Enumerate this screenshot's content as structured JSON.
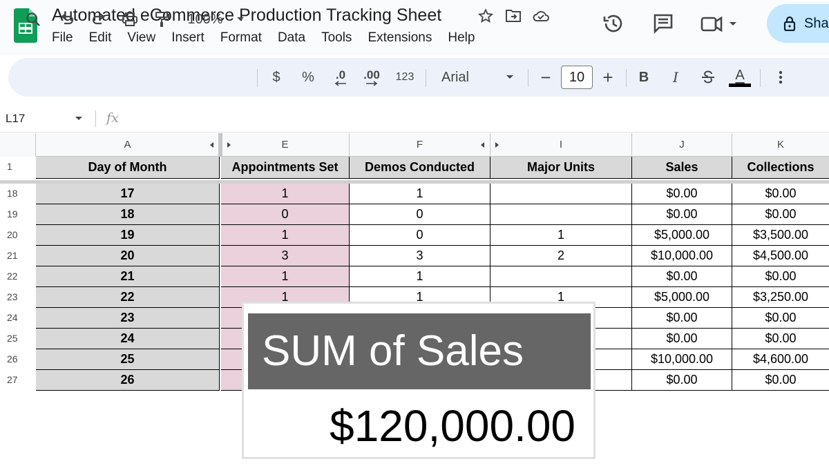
{
  "doc": {
    "title": "Automated eCommerce Production Tracking Sheet",
    "menu": [
      "File",
      "Edit",
      "View",
      "Insert",
      "Format",
      "Data",
      "Tools",
      "Extensions",
      "Help"
    ],
    "share_label": "Sha"
  },
  "toolbar": {
    "zoom": "100%",
    "currency": "$",
    "percent": "%",
    "decrease_decimal": ".0",
    "increase_decimal": ".00",
    "number_format": "123",
    "font": "Arial",
    "font_size": "10",
    "minus": "−",
    "plus": "+",
    "bold": "B",
    "italic": "I",
    "text_color": "A"
  },
  "formula_bar": {
    "cell_ref": "L17",
    "fx": "fx"
  },
  "columns": [
    "A",
    "E",
    "F",
    "I",
    "J",
    "K"
  ],
  "header_row": {
    "rownum": "1",
    "cells": [
      "Day of Month",
      "Appointments Set",
      "Demos Conducted",
      "Major Units",
      "Sales",
      "Collections"
    ]
  },
  "rows": [
    {
      "rownum": "18",
      "cells": [
        "17",
        "1",
        "1",
        "",
        "$0.00",
        "$0.00"
      ]
    },
    {
      "rownum": "19",
      "cells": [
        "18",
        "0",
        "0",
        "",
        "$0.00",
        "$0.00"
      ]
    },
    {
      "rownum": "20",
      "cells": [
        "19",
        "1",
        "0",
        "1",
        "$5,000.00",
        "$3,500.00"
      ]
    },
    {
      "rownum": "21",
      "cells": [
        "20",
        "3",
        "3",
        "2",
        "$10,000.00",
        "$4,500.00"
      ]
    },
    {
      "rownum": "22",
      "cells": [
        "21",
        "1",
        "1",
        "",
        "$0.00",
        "$0.00"
      ]
    },
    {
      "rownum": "23",
      "cells": [
        "22",
        "1",
        "1",
        "1",
        "$5,000.00",
        "$3,250.00"
      ]
    },
    {
      "rownum": "24",
      "cells": [
        "23",
        "",
        "",
        "",
        "$0.00",
        "$0.00"
      ]
    },
    {
      "rownum": "25",
      "cells": [
        "24",
        "",
        "",
        "",
        "$0.00",
        "$0.00"
      ]
    },
    {
      "rownum": "26",
      "cells": [
        "25",
        "",
        "",
        "",
        "$10,000.00",
        "$4,600.00"
      ]
    },
    {
      "rownum": "27",
      "cells": [
        "26",
        "",
        "",
        "",
        "$0.00",
        "$0.00"
      ]
    }
  ],
  "overlay": {
    "label": "SUM of Sales",
    "value": "$120,000.00"
  },
  "colors": {
    "header_fill": "#d9d9d9",
    "pink_fill": "#ead1dc",
    "share_bg": "#c2e7ff",
    "sheets_green": "#0f9d58",
    "overlay_head": "#666666"
  }
}
